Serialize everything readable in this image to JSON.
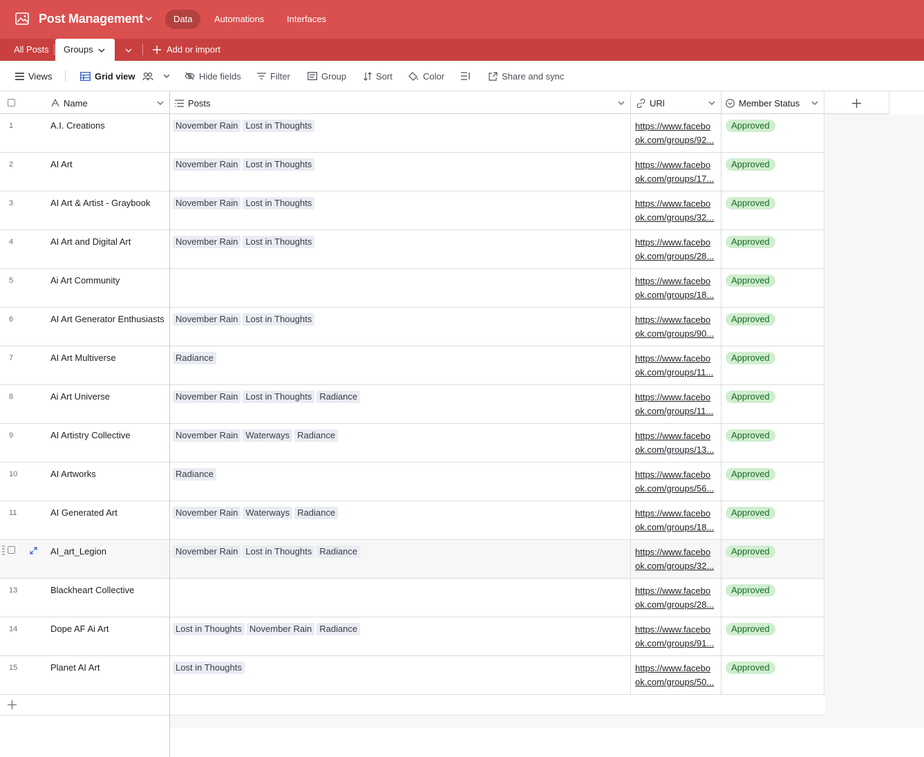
{
  "header": {
    "app_title": "Post Management",
    "nav": [
      "Data",
      "Automations",
      "Interfaces"
    ],
    "accent_color": "#d9504f"
  },
  "tabs": {
    "items": [
      "All Posts",
      "Groups"
    ],
    "active": "Groups",
    "add_label": "Add or import"
  },
  "toolbar": {
    "views": "Views",
    "grid_view": "Grid view",
    "hide_fields": "Hide fields",
    "filter": "Filter",
    "group": "Group",
    "sort": "Sort",
    "color": "Color",
    "share": "Share and sync"
  },
  "columns": {
    "name": "Name",
    "posts": "Posts",
    "url": "URl",
    "status": "Member Status"
  },
  "rows": [
    {
      "num": "1",
      "name": "A.I. Creations",
      "posts": [
        "November Rain",
        "Lost in Thoughts"
      ],
      "url1": "https://www.facebo",
      "url2": "ok.com/groups/92...",
      "status": "Approved"
    },
    {
      "num": "2",
      "name": "AI Art",
      "posts": [
        "November Rain",
        "Lost in Thoughts"
      ],
      "url1": "https://www.facebo",
      "url2": "ok.com/groups/17...",
      "status": "Approved"
    },
    {
      "num": "3",
      "name": "AI Art & Artist - Graybook",
      "posts": [
        "November Rain",
        "Lost in Thoughts"
      ],
      "url1": "https://www.facebo",
      "url2": "ok.com/groups/32...",
      "status": "Approved"
    },
    {
      "num": "4",
      "name": "AI Art and Digital Art",
      "posts": [
        "November Rain",
        "Lost in Thoughts"
      ],
      "url1": "https://www.facebo",
      "url2": "ok.com/groups/28...",
      "status": "Approved"
    },
    {
      "num": "5",
      "name": "Ai Art Community",
      "posts": [],
      "url1": "https://www.facebo",
      "url2": "ok.com/groups/18...",
      "status": "Approved"
    },
    {
      "num": "6",
      "name": "AI Art Generator Enthusiasts",
      "posts": [
        "November Rain",
        "Lost in Thoughts"
      ],
      "url1": "https://www.facebo",
      "url2": "ok.com/groups/90...",
      "status": "Approved"
    },
    {
      "num": "7",
      "name": "AI Art Multiverse",
      "posts": [
        "Radiance"
      ],
      "url1": "https://www.facebo",
      "url2": "ok.com/groups/11...",
      "status": "Approved"
    },
    {
      "num": "8",
      "name": "Ai Art Universe",
      "posts": [
        "November Rain",
        "Lost in Thoughts",
        "Radiance"
      ],
      "url1": "https://www.facebo",
      "url2": "ok.com/groups/11...",
      "status": "Approved"
    },
    {
      "num": "9",
      "name": "AI Artistry Collective",
      "posts": [
        "November Rain",
        "Waterways",
        "Radiance"
      ],
      "url1": "https://www.facebo",
      "url2": "ok.com/groups/13...",
      "status": "Approved"
    },
    {
      "num": "10",
      "name": "AI Artworks",
      "posts": [
        "Radiance"
      ],
      "url1": "https://www.facebo",
      "url2": "ok.com/groups/56...",
      "status": "Approved"
    },
    {
      "num": "11",
      "name": "AI Generated Art",
      "posts": [
        "November Rain",
        "Waterways",
        "Radiance"
      ],
      "url1": "https://www.facebo",
      "url2": "ok.com/groups/18...",
      "status": "Approved"
    },
    {
      "num": "",
      "name": "AI_art_Legion",
      "posts": [
        "November Rain",
        "Lost in Thoughts",
        "Radiance"
      ],
      "url1": "https://www.facebo",
      "url2": "ok.com/groups/32...",
      "status": "Approved",
      "hover": true
    },
    {
      "num": "13",
      "name": "Blackheart Collective",
      "posts": [],
      "url1": "https://www.facebo",
      "url2": "ok.com/groups/28...",
      "status": "Approved"
    },
    {
      "num": "14",
      "name": "Dope AF Ai Art",
      "posts": [
        "Lost in Thoughts",
        "November Rain",
        "Radiance"
      ],
      "url1": "https://www.facebo",
      "url2": "ok.com/groups/91...",
      "status": "Approved"
    },
    {
      "num": "15",
      "name": "Planet AI Art",
      "posts": [
        "Lost in Thoughts"
      ],
      "url1": "https://www.facebo",
      "url2": "ok.com/groups/50...",
      "status": "Approved"
    }
  ]
}
